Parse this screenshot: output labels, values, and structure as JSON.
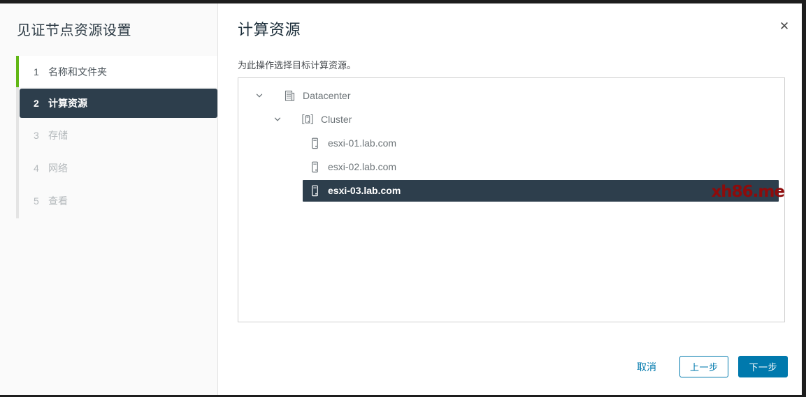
{
  "dialog": {
    "sidebar": {
      "title": "见证节点资源设置",
      "steps": [
        {
          "num": "1",
          "label": "名称和文件夹",
          "state": "done"
        },
        {
          "num": "2",
          "label": "计算资源",
          "state": "active"
        },
        {
          "num": "3",
          "label": "存储",
          "state": "pending"
        },
        {
          "num": "4",
          "label": "网络",
          "state": "pending"
        },
        {
          "num": "5",
          "label": "查看",
          "state": "pending"
        }
      ]
    },
    "main": {
      "title": "计算资源",
      "description": "为此操作选择目标计算资源。",
      "close_icon": "close-icon",
      "tree": {
        "nodes": [
          {
            "label": "Datacenter",
            "level": 0,
            "icon": "datacenter-icon",
            "expanded": true,
            "selected": false
          },
          {
            "label": "Cluster",
            "level": 1,
            "icon": "cluster-icon",
            "expanded": true,
            "selected": false
          },
          {
            "label": "esxi-01.lab.com",
            "level": 2,
            "icon": "host-icon",
            "expanded": null,
            "selected": false
          },
          {
            "label": "esxi-02.lab.com",
            "level": 2,
            "icon": "host-icon",
            "expanded": null,
            "selected": false
          },
          {
            "label": "esxi-03.lab.com",
            "level": 2,
            "icon": "host-icon",
            "expanded": null,
            "selected": true
          }
        ]
      },
      "watermark": "xh86.me",
      "footer": {
        "cancel_label": "取消",
        "back_label": "上一步",
        "next_label": "下一步"
      }
    },
    "colors": {
      "accent_blue": "#0079ad",
      "selected_navy": "#2d3e4c",
      "done_green": "#61b715",
      "watermark_red": "#8e0b0b"
    }
  }
}
